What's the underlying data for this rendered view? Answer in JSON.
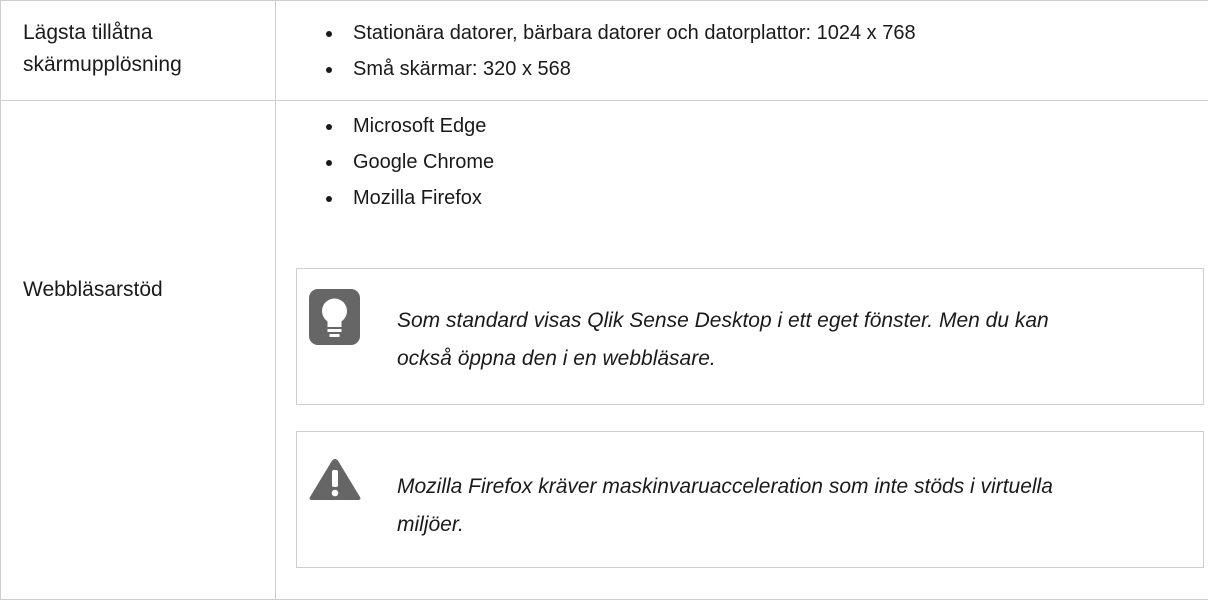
{
  "rows": [
    {
      "label": "Lägsta tillåtna skärmupplösning",
      "items": [
        "Stationära datorer, bärbara datorer och datorplattor: 1024 x 768",
        "Små skärmar: 320 x 568"
      ]
    },
    {
      "label": "Webbläsarstöd",
      "items": [
        "Microsoft Edge",
        "Google Chrome",
        "Mozilla Firefox"
      ],
      "tip": {
        "icon": "lightbulb-icon",
        "text": "Som standard visas Qlik Sense Desktop i ett eget fönster. Men du kan också öppna den i en webbläsare."
      },
      "warning": {
        "icon": "warning-icon",
        "text": "Mozilla Firefox kräver maskinvaruacceleration som inte stöds i virtuella miljöer."
      }
    }
  ],
  "colors": {
    "border": "#cfcfcf",
    "icon": "#666666",
    "text": "#1a1a1a"
  }
}
